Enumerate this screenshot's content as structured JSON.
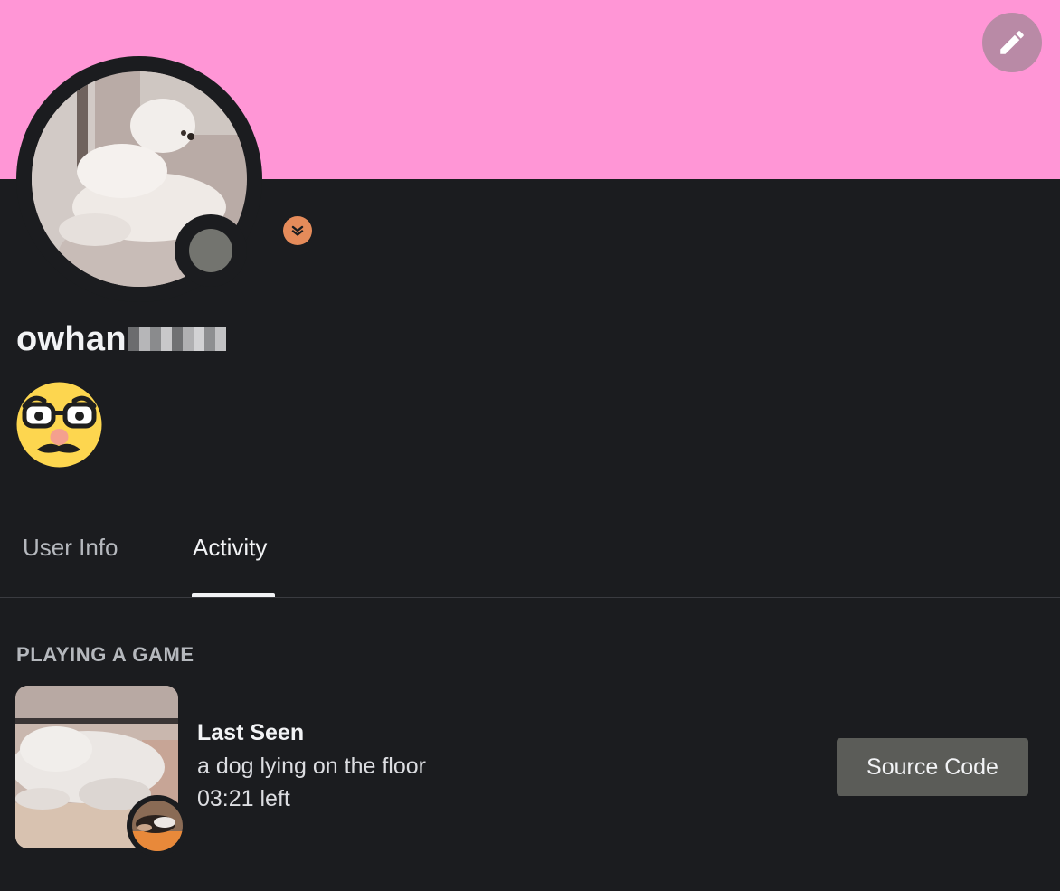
{
  "profile": {
    "username": "owhan",
    "username_redacted": true
  },
  "banner": {
    "color": "#ff96d6",
    "edit_icon": "pencil-icon"
  },
  "avatar": {
    "status": "offline",
    "status_color": "#73746f",
    "badge_icon": "chevron-down-icon",
    "badge_color": "#e58b5a"
  },
  "custom_status": {
    "emoji_icon": "disguised-face-icon"
  },
  "tabs": [
    {
      "label": "User Info",
      "active": false
    },
    {
      "label": "Activity",
      "active": true
    }
  ],
  "activity": {
    "section_header": "PLAYING A GAME",
    "title": "Last Seen",
    "details": "a dog lying on the floor",
    "time_left": "03:21 left",
    "button_label": "Source Code"
  },
  "colors": {
    "background": "#1b1c1f",
    "button": "#5b5c58",
    "muted_text": "#b5b8bd"
  }
}
